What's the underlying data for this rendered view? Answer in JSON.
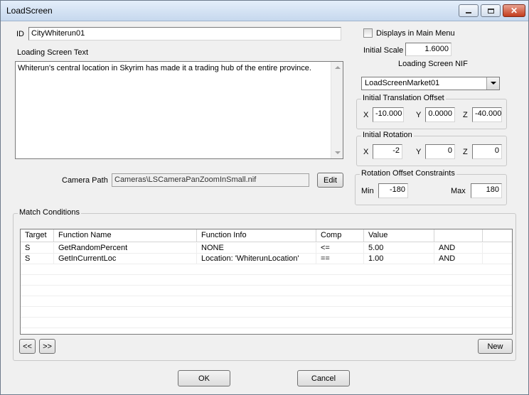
{
  "window": {
    "title": "LoadScreen"
  },
  "id_label": "ID",
  "id_value": "CityWhiterun01",
  "text_label": "Loading Screen Text",
  "text_value": "Whiterun's central location in Skyrim has made it a trading hub of the entire province.",
  "displays_main_menu_label": "Displays in Main Menu",
  "displays_main_menu_checked": false,
  "initial_scale_label": "Initial Scale",
  "initial_scale_value": "1.6000",
  "nif_label": "Loading Screen NIF",
  "nif_value": "LoadScreenMarket01",
  "translation": {
    "title": "Initial Translation Offset",
    "x_label": "X",
    "x": "-10.000",
    "y_label": "Y",
    "y": "0.0000",
    "z_label": "Z",
    "z": "-40.000"
  },
  "rotation": {
    "title": "Initial Rotation",
    "x_label": "X",
    "x": "-2",
    "y_label": "Y",
    "y": "0",
    "z_label": "Z",
    "z": "0"
  },
  "constraints": {
    "title": "Rotation Offset Constraints",
    "min_label": "Min",
    "min": "-180",
    "max_label": "Max",
    "max": "180"
  },
  "camera_path_label": "Camera Path",
  "camera_path_value": "Cameras\\LSCameraPanZoomInSmall.nif",
  "edit_label": "Edit",
  "conditions": {
    "title": "Match Conditions",
    "columns": [
      "Target",
      "Function Name",
      "Function Info",
      "Comp",
      "Value",
      ""
    ],
    "rows": [
      [
        "S",
        "GetRandomPercent",
        "NONE",
        "<=",
        "5.00",
        "AND"
      ],
      [
        "S",
        "GetInCurrentLoc",
        "Location: 'WhiterunLocation'",
        "==",
        "1.00",
        "AND"
      ]
    ],
    "prev_label": "<<",
    "next_label": ">>",
    "new_label": "New"
  },
  "ok_label": "OK",
  "cancel_label": "Cancel"
}
